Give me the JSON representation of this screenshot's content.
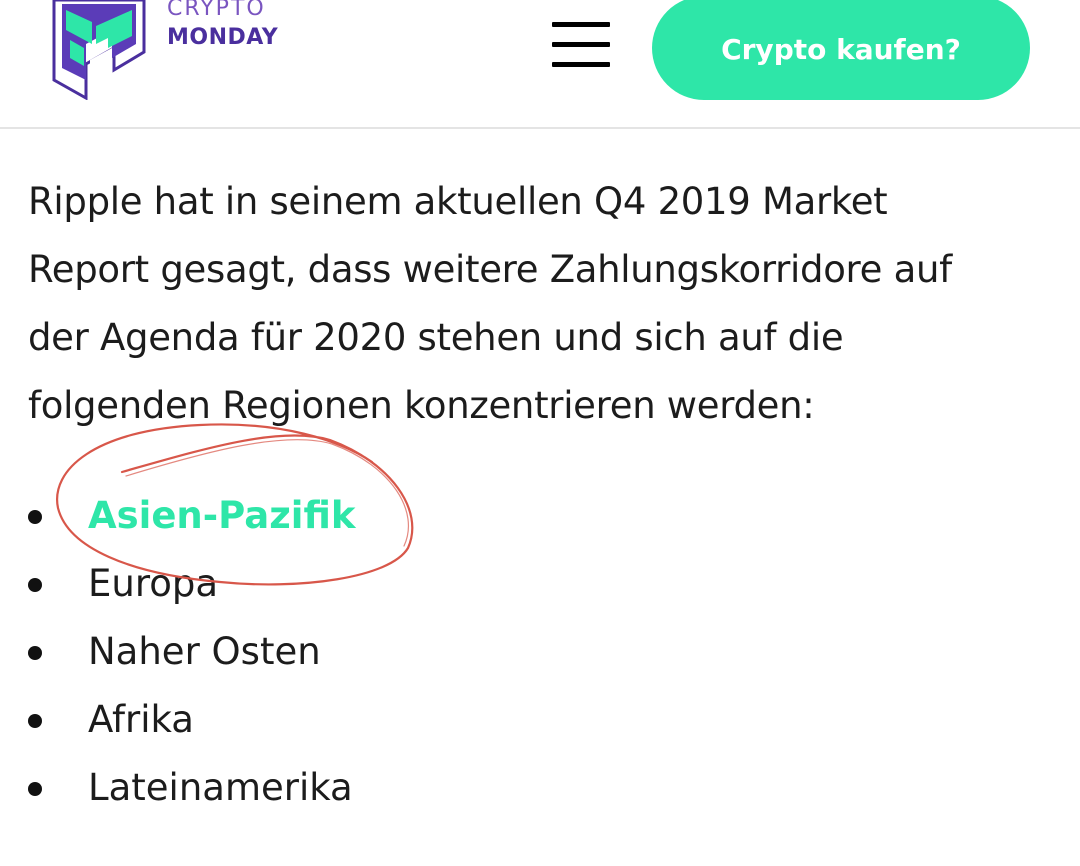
{
  "header": {
    "logo": {
      "line1": "CRYPTO",
      "line2": "MONDAY"
    },
    "menu_icon": "hamburger-menu-icon",
    "cta_label": "Crypto kaufen?"
  },
  "colors": {
    "accent": "#2ee6a8",
    "logo_purple": "#4a2f9e",
    "logo_purple_light": "#7a55c0",
    "annotation_red": "#d8574a"
  },
  "article": {
    "paragraph_lines": [
      "Ripple hat in seinem aktuellen Q4 2019 Market",
      "Report gesagt, dass weitere Zahlungskorridore auf",
      "der Agenda für 2020 stehen und sich auf die",
      "folgenden Regionen konzentrieren werden:"
    ],
    "regions": [
      "Asien-Pazifik",
      "Europa",
      "Naher Osten",
      "Afrika",
      "Lateinamerika"
    ],
    "highlighted_region": "Asien-Pazifik"
  }
}
